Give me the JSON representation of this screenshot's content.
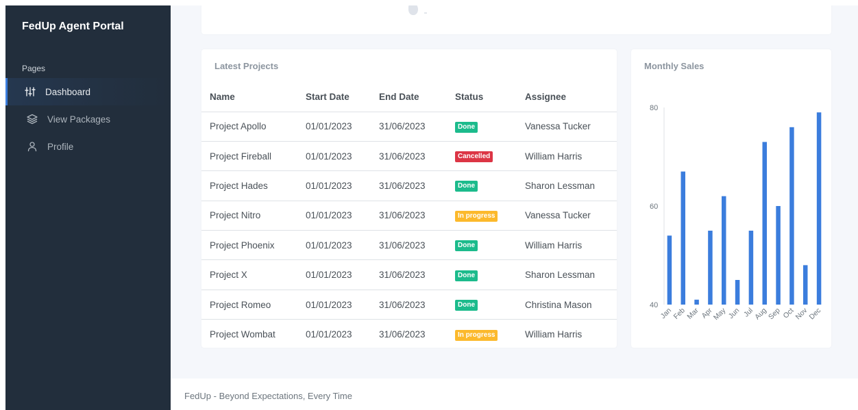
{
  "sidebar": {
    "brand": "FedUp Agent Portal",
    "section_header": "Pages",
    "items": [
      {
        "label": "Dashboard",
        "icon": "sliders-icon",
        "active": true
      },
      {
        "label": "View Packages",
        "icon": "layers-icon",
        "active": false
      },
      {
        "label": "Profile",
        "icon": "user-icon",
        "active": false
      }
    ]
  },
  "projects": {
    "title": "Latest Projects",
    "columns": [
      "Name",
      "Start Date",
      "End Date",
      "Status",
      "Assignee"
    ],
    "rows": [
      {
        "name": "Project Apollo",
        "start": "01/01/2023",
        "end": "31/06/2023",
        "status": "Done",
        "assignee": "Vanessa Tucker"
      },
      {
        "name": "Project Fireball",
        "start": "01/01/2023",
        "end": "31/06/2023",
        "status": "Cancelled",
        "assignee": "William Harris"
      },
      {
        "name": "Project Hades",
        "start": "01/01/2023",
        "end": "31/06/2023",
        "status": "Done",
        "assignee": "Sharon Lessman"
      },
      {
        "name": "Project Nitro",
        "start": "01/01/2023",
        "end": "31/06/2023",
        "status": "In progress",
        "assignee": "Vanessa Tucker"
      },
      {
        "name": "Project Phoenix",
        "start": "01/01/2023",
        "end": "31/06/2023",
        "status": "Done",
        "assignee": "William Harris"
      },
      {
        "name": "Project X",
        "start": "01/01/2023",
        "end": "31/06/2023",
        "status": "Done",
        "assignee": "Sharon Lessman"
      },
      {
        "name": "Project Romeo",
        "start": "01/01/2023",
        "end": "31/06/2023",
        "status": "Done",
        "assignee": "Christina Mason"
      },
      {
        "name": "Project Wombat",
        "start": "01/01/2023",
        "end": "31/06/2023",
        "status": "In progress",
        "assignee": "William Harris"
      }
    ]
  },
  "status_colors": {
    "Done": "#1cbb8c",
    "Cancelled": "#dc3545",
    "In progress": "#fcb92c"
  },
  "sales": {
    "title": "Monthly Sales",
    "bar_color": "#3b7ddd"
  },
  "chart_data": {
    "type": "bar",
    "categories": [
      "Jan",
      "Feb",
      "Mar",
      "Apr",
      "May",
      "Jun",
      "Jul",
      "Aug",
      "Sep",
      "Oct",
      "Nov",
      "Dec"
    ],
    "values": [
      54,
      67,
      41,
      55,
      62,
      45,
      55,
      73,
      60,
      76,
      48,
      79
    ],
    "yticks": [
      40,
      60,
      80
    ],
    "ylim": [
      40,
      80
    ],
    "grid": false,
    "legend": "none"
  },
  "footer": {
    "text": "FedUp - Beyond Expectations, Every Time"
  }
}
